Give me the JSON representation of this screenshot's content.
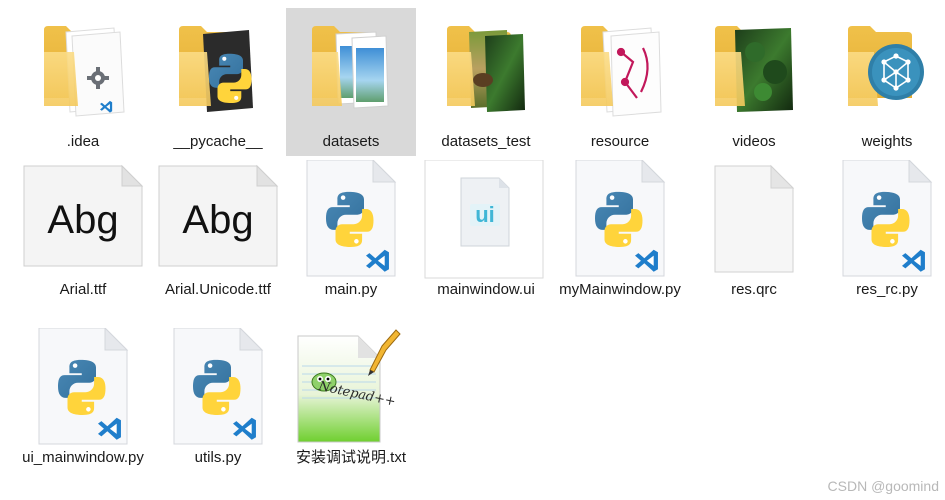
{
  "items": [
    {
      "name": ".idea"
    },
    {
      "name": "__pycache__"
    },
    {
      "name": "datasets"
    },
    {
      "name": "datasets_test"
    },
    {
      "name": "resource"
    },
    {
      "name": "videos"
    },
    {
      "name": "weights"
    },
    {
      "name": "Arial.ttf"
    },
    {
      "name": "Arial.Unicode.ttf"
    },
    {
      "name": "main.py"
    },
    {
      "name": "mainwindow.ui"
    },
    {
      "name": "myMainwindow.py"
    },
    {
      "name": "res.qrc"
    },
    {
      "name": "res_rc.py"
    },
    {
      "name": "ui_mainwindow.py"
    },
    {
      "name": "utils.py"
    },
    {
      "name": "安装调试说明.txt"
    }
  ],
  "font_preview_text": "Abg",
  "ui_icon_text": "ui",
  "notepad_text": "Notepad++",
  "watermark": "CSDN @goomind",
  "colors": {
    "folder": "#f6cf6a",
    "folder_dark": "#e8b844",
    "selection": "#d9d9d9",
    "python_blue": "#3f7ba3",
    "python_yellow": "#ffd43b",
    "vscode_blue": "#1f7ecb"
  }
}
